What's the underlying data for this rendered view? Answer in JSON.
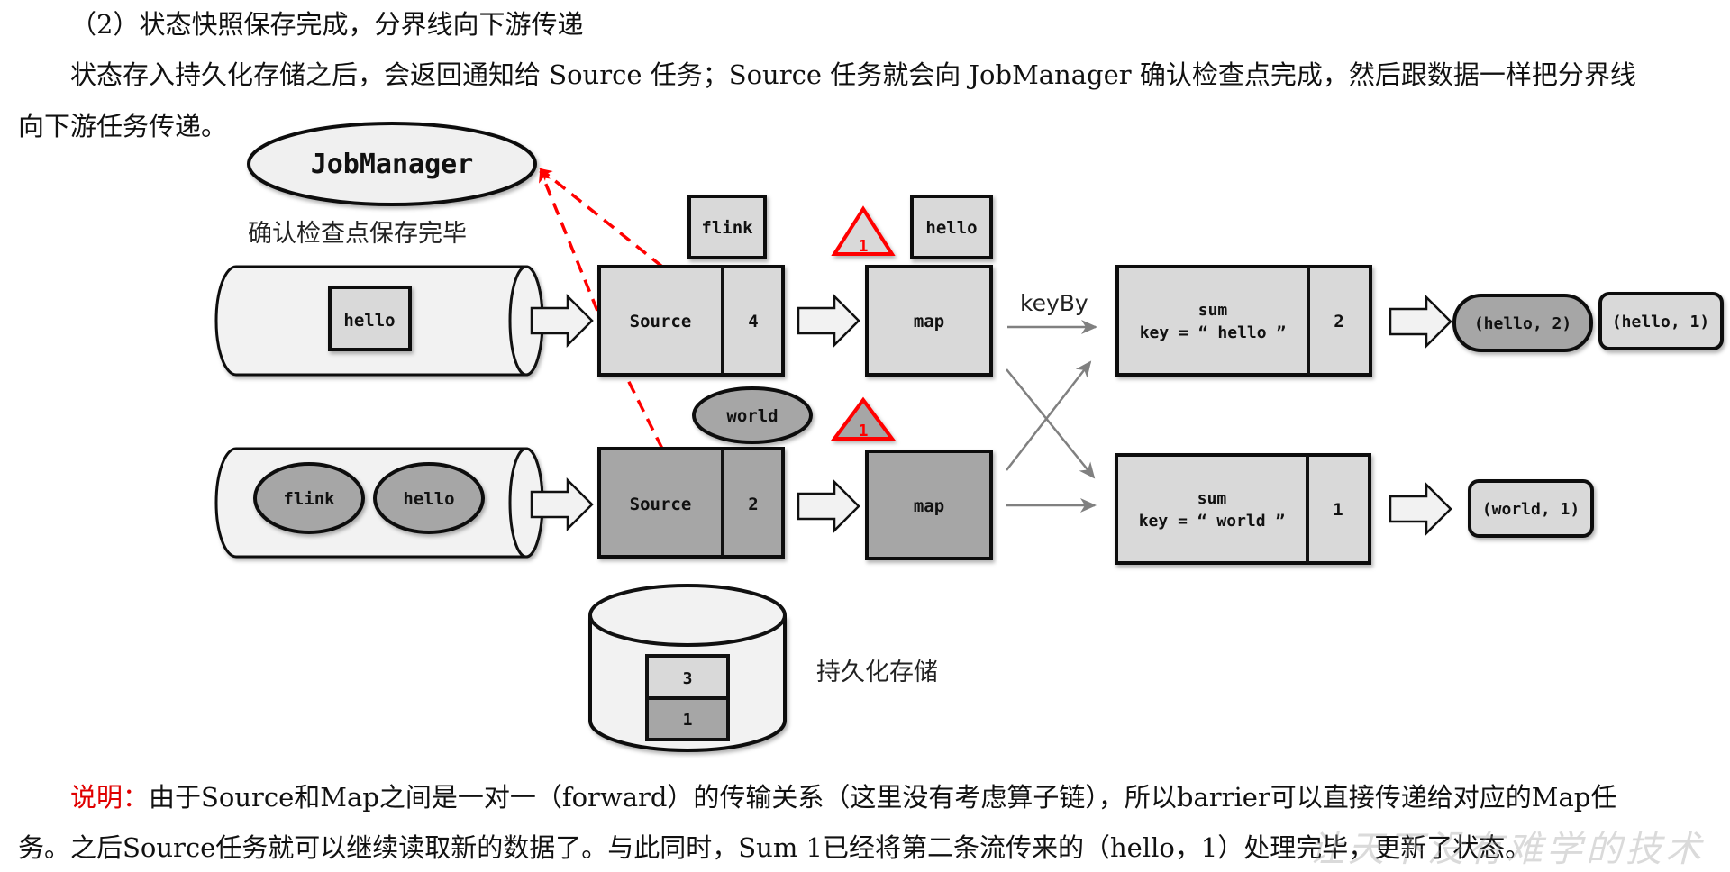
{
  "heading": "（2）状态快照保存完成，分界线向下游传递",
  "intro": {
    "line1": "状态存入持久化存储之后，会返回通知给 Source 任务；Source 任务就会向 JobManager 确认检查点完成，然后跟数据一样把分界线",
    "line2": "向下游任务传递。"
  },
  "diagram": {
    "jobmanager": "JobManager",
    "ack_label": "确认检查点保存完毕",
    "keyby_label": "keyBy",
    "storage_label": "持久化存储",
    "stream1": {
      "queue": [
        "hello"
      ],
      "source_label": "Source",
      "source_offset": "4",
      "in_flight": "flink",
      "barrier": "1",
      "map_label": "map",
      "map_incoming": "hello"
    },
    "stream2": {
      "queue": [
        "flink",
        "hello"
      ],
      "source_label": "Source",
      "source_offset": "2",
      "in_flight": "world",
      "barrier": "1",
      "map_label": "map"
    },
    "sum1": {
      "title": "sum",
      "key": "key = “ hello ”",
      "state": "2"
    },
    "sum2": {
      "title": "sum",
      "key": "key = “ world ”",
      "state": "1"
    },
    "outputs1": [
      "(hello, 2)",
      "(hello, 1)"
    ],
    "outputs2": [
      "(world, 1)"
    ],
    "storage_values": [
      "3",
      "1"
    ]
  },
  "note": {
    "label": "说明：",
    "line1": "由于Source和Map之间是一对一（forward）的传输关系（这里没有考虑算子链），所以barrier可以直接传递给对应的Map任",
    "line2": "务。之后Source任务就可以继续读取新的数据了。与此同时，Sum 1已经将第二条流传来的（hello，1）处理完毕，更新了状态。"
  },
  "watermark": "让天下没有难学的技术",
  "colors": {
    "light_fill": "#d9d9d9",
    "dark_fill": "#a6a6a6",
    "pipe_fill": "#f2f2f2",
    "barrier_red": "#ff0000",
    "edge_gray": "#808080"
  }
}
